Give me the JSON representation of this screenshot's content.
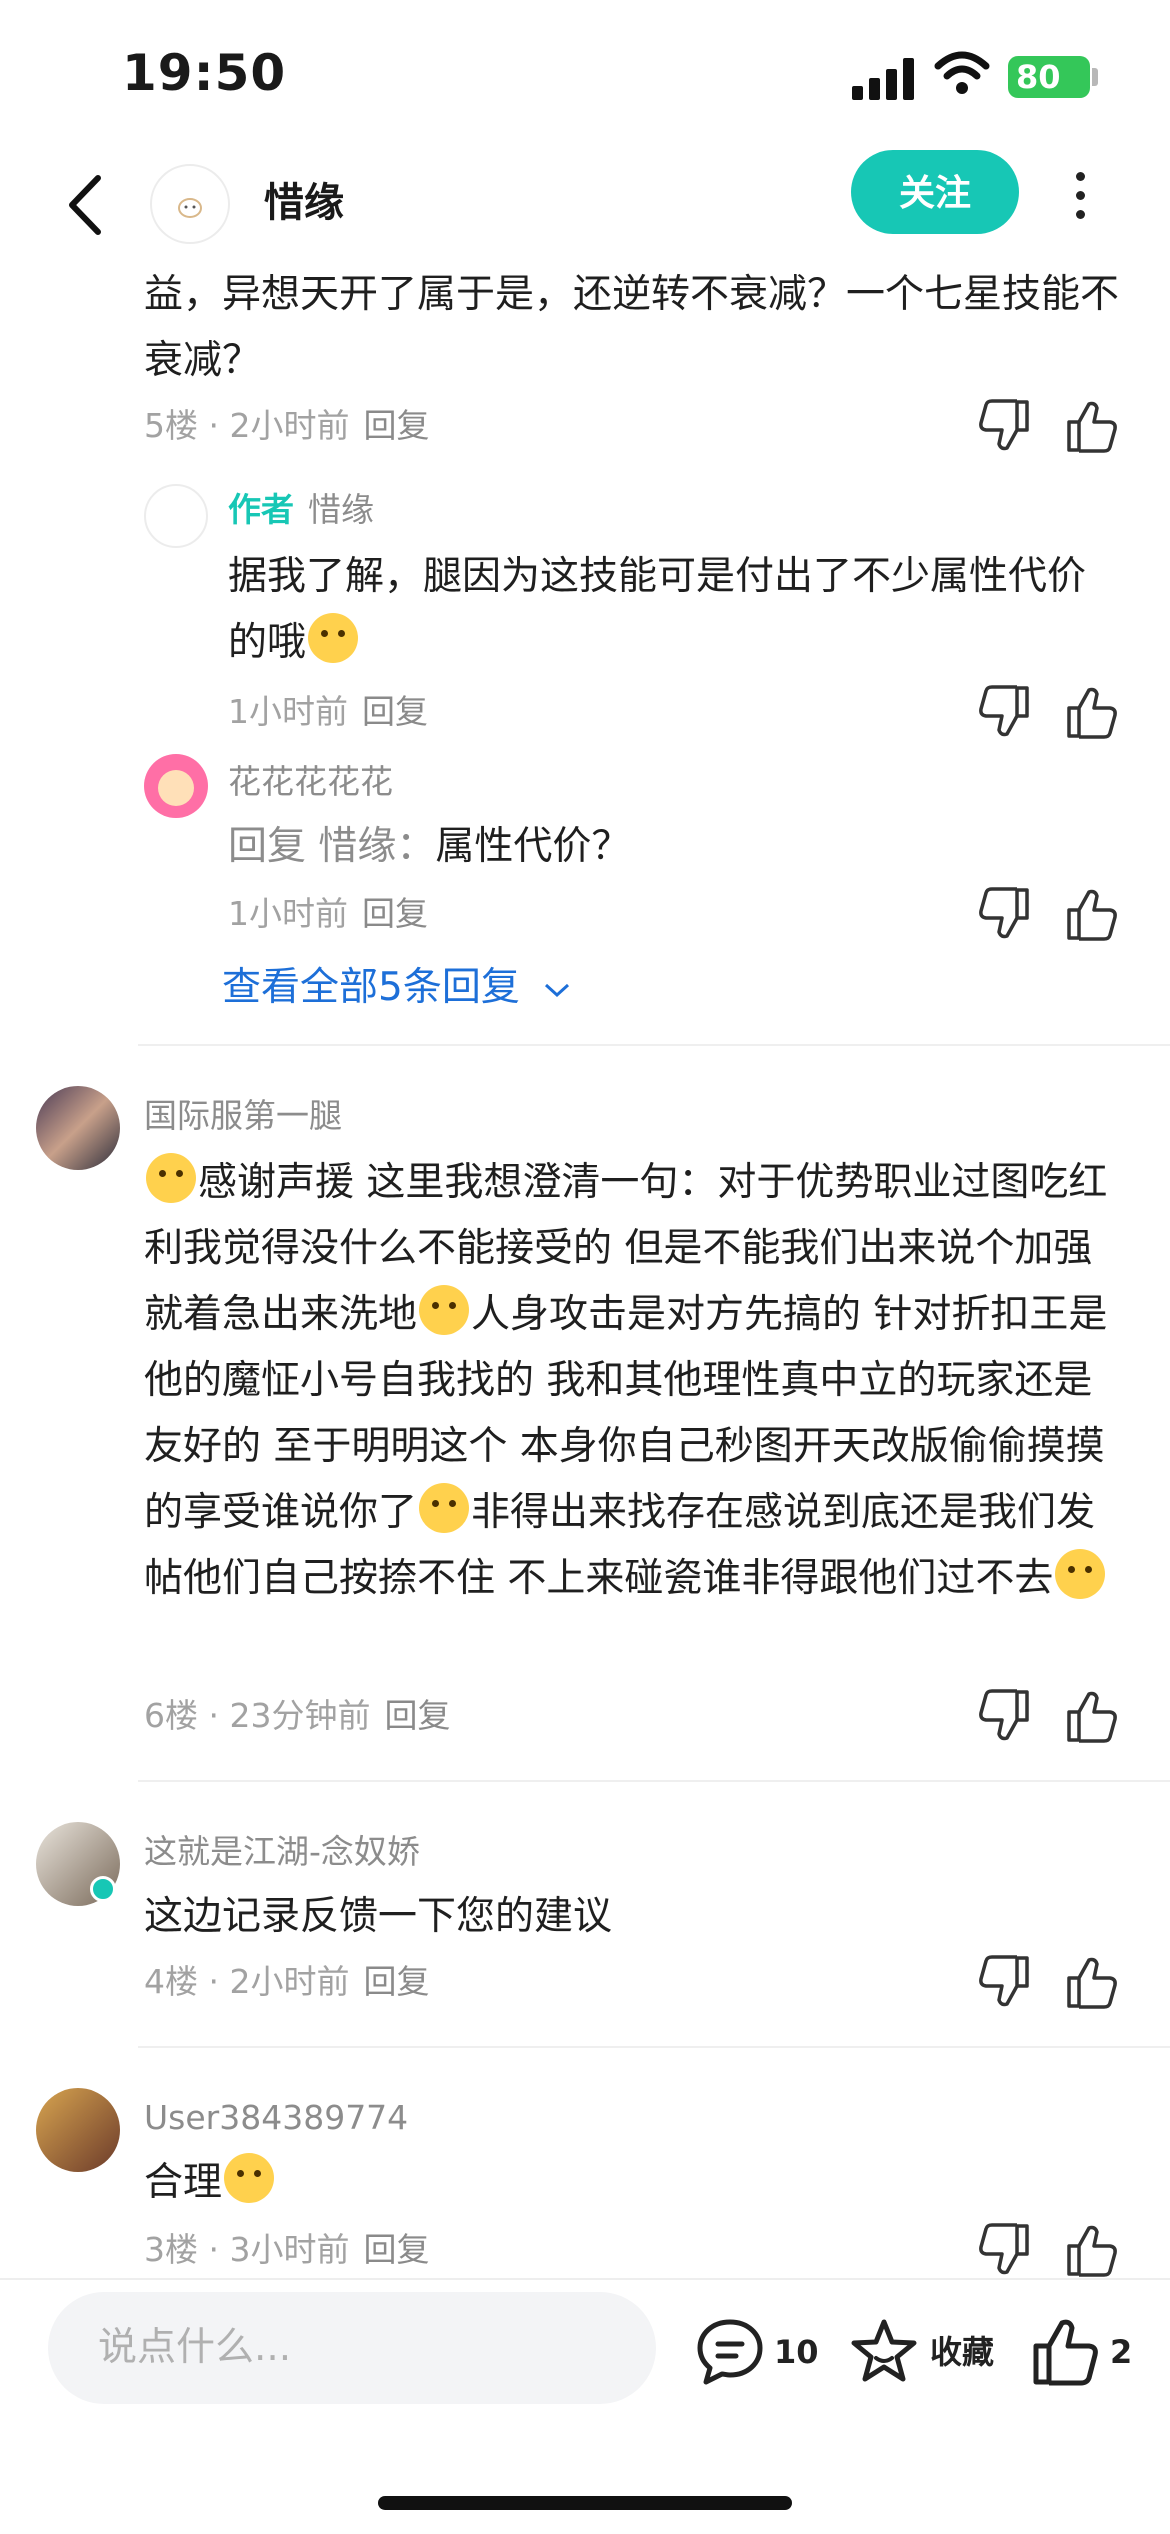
{
  "status": {
    "time": "19:50",
    "battery": "80"
  },
  "nav": {
    "name": "惜缘",
    "follow_label": "关注"
  },
  "comments": {
    "c5": {
      "text": "益，异想天开了属于是，还逆转不衰减？一个七星技能不衰减？",
      "floor": "5楼",
      "time": "2小时前",
      "reply_label": "回复"
    },
    "r1": {
      "author_tag": "作者",
      "name": "惜缘",
      "text": "据我了解，腿因为这技能可是付出了不少属性代价的哦",
      "time": "1小时前",
      "reply_label": "回复"
    },
    "r2": {
      "name": "花花花花花",
      "reply_prefix": "回复 惜缘：",
      "text": "属性代价？",
      "time": "1小时前",
      "reply_label": "回复"
    },
    "view_all": "查看全部5条回复",
    "c6": {
      "name": "国际服第一腿",
      "t1": "感谢声援 这里我想澄清一句：对于优势职业过图吃红利我觉得没什么不能接受的 但是不能我们出来说个加强 就着急出来洗地",
      "t2": "人身攻击是对方先搞的 针对折扣王是他的魔怔小号自我找的 我和其他理性真中立的玩家还是友好的 至于明明这个 本身你自己秒图开天改版偷偷摸摸的享受谁说你了",
      "t3": "非得出来找存在感说到底还是我们发帖他们自己按捺不住 不上来碰瓷谁非得跟他们过不去",
      "floor": "6楼",
      "time": "23分钟前",
      "reply_label": "回复"
    },
    "c4": {
      "name": "这就是江湖-念奴娇",
      "text": "这边记录反馈一下您的建议",
      "floor": "4楼",
      "time": "2小时前",
      "reply_label": "回复"
    },
    "c3": {
      "name": "User384389774",
      "text": "合理",
      "floor": "3楼",
      "time": "3小时前",
      "reply_label": "回复"
    }
  },
  "bottom": {
    "placeholder": "说点什么...",
    "comment_count": "10",
    "collect_label": "收藏",
    "like_count": "2"
  },
  "colors": {
    "accent": "#17c7b5",
    "link": "#1d6fd8",
    "battery": "#34c759"
  }
}
